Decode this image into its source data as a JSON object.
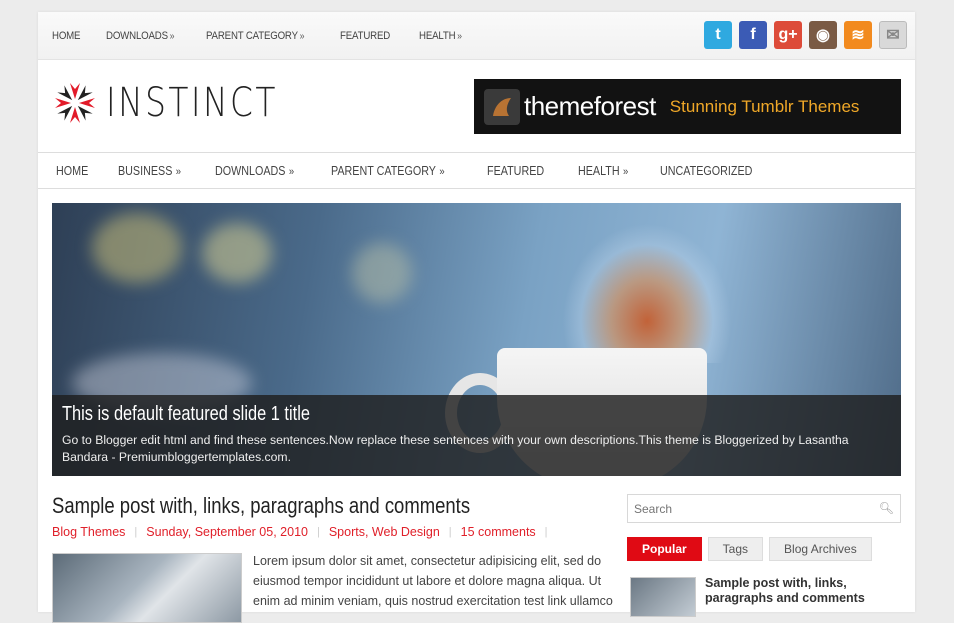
{
  "topnav": [
    {
      "label": "HOME",
      "has_arrow": false
    },
    {
      "label": "DOWNLOADS",
      "has_arrow": true
    },
    {
      "label": "PARENT CATEGORY",
      "has_arrow": true
    },
    {
      "label": "FEATURED",
      "has_arrow": false
    },
    {
      "label": "HEALTH",
      "has_arrow": true
    }
  ],
  "arrow_glyph": "»",
  "social": [
    {
      "icon": "twitter-icon",
      "color": "#2fa9e0",
      "glyph": "t"
    },
    {
      "icon": "facebook-icon",
      "color": "#3b5bb5",
      "glyph": "f"
    },
    {
      "icon": "google-plus-icon",
      "color": "#dd4b39",
      "glyph": "g+"
    },
    {
      "icon": "instagram-icon",
      "color": "#7a5a44",
      "glyph": "◉"
    },
    {
      "icon": "rss-icon",
      "color": "#f28a1e",
      "glyph": "≋"
    },
    {
      "icon": "email-icon",
      "color": "#d9d9d9",
      "glyph": "✉"
    }
  ],
  "logo": {
    "name": "INSTINCT",
    "accent": "#e21b2a"
  },
  "banner": {
    "brand": "themeforest",
    "tagline": "Stunning Tumblr Themes"
  },
  "mainnav": [
    {
      "label": "HOME",
      "has_arrow": false
    },
    {
      "label": "BUSINESS",
      "has_arrow": true
    },
    {
      "label": "DOWNLOADS",
      "has_arrow": true
    },
    {
      "label": "PARENT CATEGORY",
      "has_arrow": true
    },
    {
      "label": "FEATURED",
      "has_arrow": false
    },
    {
      "label": "HEALTH",
      "has_arrow": true
    },
    {
      "label": "UNCATEGORIZED",
      "has_arrow": false
    }
  ],
  "slider": {
    "title": "This is default featured slide 1 title",
    "description": "Go to Blogger edit html and find these sentences.Now replace these sentences with your own descriptions.This theme is Bloggerized by Lasantha Bandara - Premiumbloggertemplates.com."
  },
  "post": {
    "title": "Sample post with, links, paragraphs and comments",
    "meta": [
      "Blog Themes",
      "Sunday, September 05, 2010",
      "Sports, Web Design",
      "15 comments"
    ],
    "excerpt": "Lorem ipsum dolor sit amet, consectetur adipisicing elit, sed do eiusmod tempor incididunt ut labore et dolore magna aliqua. Ut enim ad minim veniam, quis nostrud exercitation test link ullamco"
  },
  "sidebar": {
    "search_placeholder": "Search",
    "tabs": [
      "Popular",
      "Tags",
      "Blog Archives"
    ],
    "popular_title": "Sample post with, links, paragraphs and comments"
  }
}
